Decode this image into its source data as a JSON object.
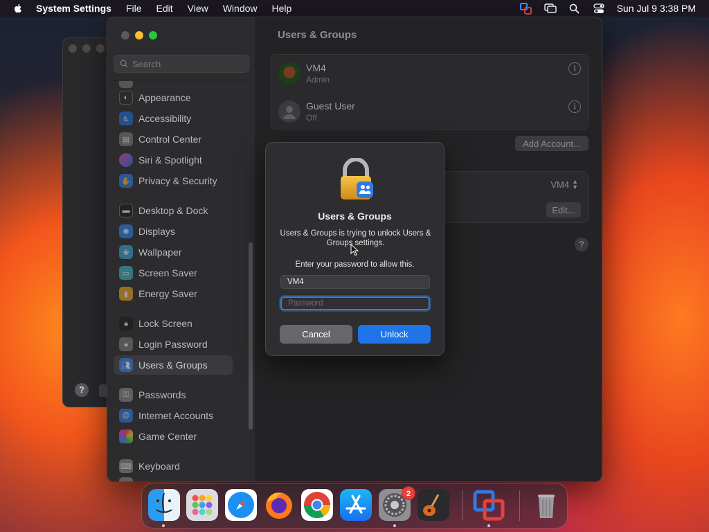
{
  "menubar": {
    "app_name": "System Settings",
    "menus": [
      "File",
      "Edit",
      "View",
      "Window",
      "Help"
    ],
    "clock": "Sun Jul 9  3:38 PM"
  },
  "search": {
    "placeholder": "Search"
  },
  "sidebar": {
    "items": [
      {
        "label": "Appearance",
        "icon": "appearance-icon",
        "color": "#2b2b2b"
      },
      {
        "label": "Accessibility",
        "icon": "accessibility-icon",
        "color": "#1f6fe0"
      },
      {
        "label": "Control Center",
        "icon": "control-center-icon",
        "color": "#7a7a7a"
      },
      {
        "label": "Siri & Spotlight",
        "icon": "siri-icon",
        "color": "#b23ad1"
      },
      {
        "label": "Privacy & Security",
        "icon": "hand-icon",
        "color": "#2f7be6"
      },
      {
        "label": "Desktop & Dock",
        "icon": "desktop-dock-icon",
        "color": "#1c1c1c"
      },
      {
        "label": "Displays",
        "icon": "displays-icon",
        "color": "#2a86f0"
      },
      {
        "label": "Wallpaper",
        "icon": "wallpaper-icon",
        "color": "#36a6d6"
      },
      {
        "label": "Screen Saver",
        "icon": "screen-saver-icon",
        "color": "#3eb5c9"
      },
      {
        "label": "Energy Saver",
        "icon": "energy-saver-icon",
        "color": "#f0a71e"
      },
      {
        "label": "Lock Screen",
        "icon": "lock-screen-icon",
        "color": "#1c1c1c"
      },
      {
        "label": "Login Password",
        "icon": "login-password-icon",
        "color": "#7b7b7b"
      },
      {
        "label": "Users & Groups",
        "icon": "users-groups-icon",
        "color": "#2f7be6"
      },
      {
        "label": "Passwords",
        "icon": "key-icon",
        "color": "#8a8a8a"
      },
      {
        "label": "Internet Accounts",
        "icon": "at-icon",
        "color": "#2f7be6"
      },
      {
        "label": "Game Center",
        "icon": "game-center-icon",
        "color": "#d8d8d8"
      },
      {
        "label": "Keyboard",
        "icon": "keyboard-icon",
        "color": "#8a8a8a"
      }
    ],
    "selected": "Users & Groups"
  },
  "content": {
    "title": "Users & Groups",
    "users": [
      {
        "name": "VM4",
        "role": "Admin"
      },
      {
        "name": "Guest User",
        "role": "Off"
      }
    ],
    "add_account_label": "Add Account...",
    "autologin_value": "VM4",
    "edit_label": "Edit..."
  },
  "dialog": {
    "title": "Users & Groups",
    "message": "Users & Groups is trying to unlock Users & Groups settings.",
    "prompt": "Enter your password to allow this.",
    "username_value": "VM4",
    "password_placeholder": "Password",
    "cancel_label": "Cancel",
    "unlock_label": "Unlock"
  },
  "dock": {
    "apps": [
      "Finder",
      "Launchpad",
      "Safari",
      "Firefox",
      "Chrome",
      "App Store",
      "System Settings",
      "GarageBand",
      "VMware Fusion",
      "Trash"
    ],
    "settings_badge": "2"
  },
  "colors": {
    "accent": "#1f74e8",
    "traffic_close": "#ff5f57",
    "traffic_min": "#febc2e",
    "traffic_max": "#28c840"
  }
}
